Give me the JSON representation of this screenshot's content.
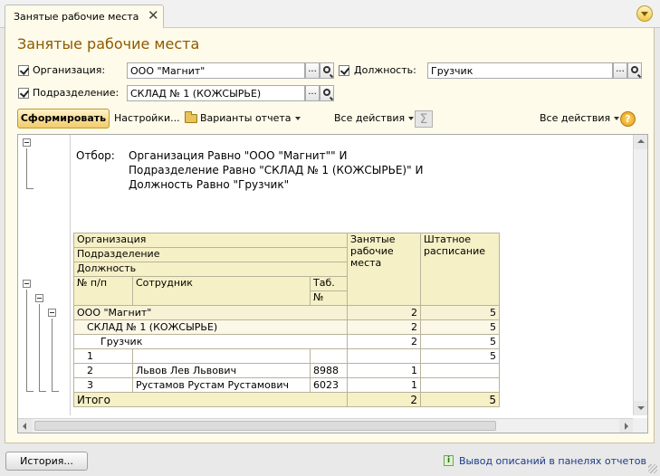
{
  "tab": {
    "label": "Занятые рабочие места"
  },
  "page_title": "Занятые рабочие места",
  "filters": {
    "organization": {
      "label": "Организация:",
      "value": "ООО \"Магнит\"",
      "btn": "..."
    },
    "position": {
      "label": "Должность:",
      "value": "Грузчик",
      "btn": "..."
    },
    "division": {
      "label": "Подразделение:",
      "value": "СКЛАД № 1 (КОЖСЫРЬЕ)",
      "btn": "..."
    }
  },
  "toolbar": {
    "generate": "Сформировать",
    "settings": "Настройки...",
    "variants": "Варианты отчета",
    "all_actions_left": "Все действия",
    "sigma": "Σ",
    "all_actions_right": "Все действия",
    "help": "?"
  },
  "report": {
    "filter_key": "Отбор:",
    "filter_lines": [
      "Организация Равно \"ООО \"Магнит\"\" И",
      "Подразделение Равно \"СКЛАД № 1 (КОЖСЫРЬЕ)\" И",
      "Должность Равно \"Грузчик\""
    ],
    "headers": {
      "org": "Организация",
      "division": "Подразделение",
      "position": "Должность",
      "num": "№ п/п",
      "employee": "Сотрудник",
      "tab_no_1": "Таб.",
      "tab_no_2": "№",
      "occupied_1": "Занятые",
      "occupied_2": "рабочие",
      "occupied_3": "места",
      "staff_1": "Штатное",
      "staff_2": "расписание"
    },
    "groups": {
      "org": {
        "name": "ООО \"Магнит\"",
        "occupied": "2",
        "staff": "5"
      },
      "division": {
        "name": "СКЛАД № 1 (КОЖСЫРЬЕ)",
        "occupied": "2",
        "staff": "5"
      },
      "position": {
        "name": "Грузчик",
        "occupied": "2",
        "staff": "5"
      }
    },
    "rows": [
      {
        "n": "1",
        "employee": "",
        "tab": "",
        "occupied": "",
        "staff": "5"
      },
      {
        "n": "2",
        "employee": "Львов Лев Львович",
        "tab": "8988",
        "occupied": "1",
        "staff": ""
      },
      {
        "n": "3",
        "employee": "Рустамов Рустам Рустамович",
        "tab": "6023",
        "occupied": "1",
        "staff": ""
      }
    ],
    "total": {
      "label": "Итого",
      "occupied": "2",
      "staff": "5"
    }
  },
  "status": {
    "history": "История...",
    "info_icon": "i",
    "link": "Вывод описаний в панелях отчетов"
  },
  "colors": {
    "accent_title": "#8c5a00",
    "form_bg": "#fffbea",
    "header_bg": "#f6f0c6"
  }
}
